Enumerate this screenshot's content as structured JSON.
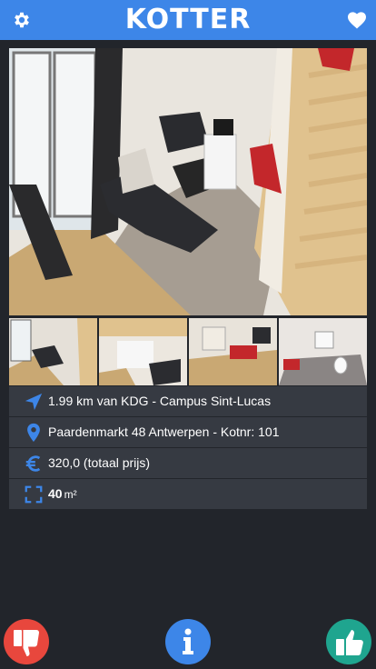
{
  "app": {
    "logo": "KOTTER"
  },
  "icons": {
    "settings": "gear-icon",
    "favorites": "heart-icon",
    "distance": "navigation-arrow-icon",
    "address": "location-pin-icon",
    "price": "euro-icon",
    "area": "expand-icon",
    "dislike": "thumbs-down-icon",
    "info": "info-icon",
    "like": "thumbs-up-icon"
  },
  "details": {
    "distance": "1.99 km van KDG - Campus Sint-Lucas",
    "address": "Paardenmarkt 48 Antwerpen - Kotnr: 101",
    "price": "320,0 (totaal prijs)",
    "area_value": "40",
    "area_unit": "m²"
  },
  "colors": {
    "accent": "#3d86e8",
    "background": "#22252b",
    "row": "#363a42",
    "dislike": "#e8473d",
    "like": "#1fa58f"
  }
}
